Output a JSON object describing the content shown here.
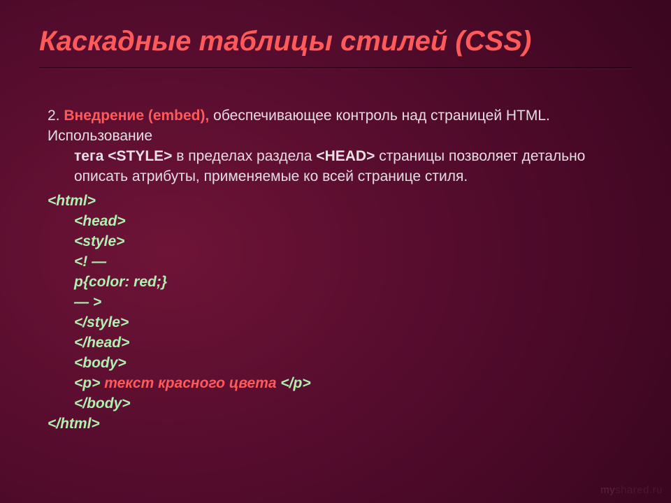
{
  "title": "Каскадные таблицы стилей (CSS)",
  "list_number": "2.",
  "embed_label": "Внедрение (embed),",
  "para_text_1": " обеспечивающее контроль над страницей HTML. Использование ",
  "tag_word": "тега ",
  "style_tag": "<STYLE>",
  "para_text_2": " в пределах раздела ",
  "head_tag": "<HEAD>",
  "para_text_3": " страницы позволяет детально описать атрибуты, применяемые ко всей странице стиля.",
  "code": {
    "l01": "<html>",
    "l02": "<head>",
    "l03": "<style>",
    "l04": "<! —",
    "l05": "p{color: red;}",
    "l06": "— >",
    "l07": "</style>",
    "l08": "</head>",
    "l09": "<body>",
    "l10a": "<p> ",
    "l10b": "текст красного цвета",
    "l10c": " </p>",
    "l11": "</body>",
    "l12": "</html>"
  },
  "watermark_my": "my",
  "watermark_rest": "shared.ru"
}
